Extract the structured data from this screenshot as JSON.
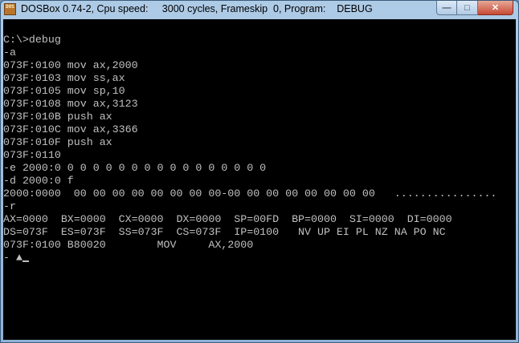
{
  "window": {
    "icon_text": "DOS",
    "title": "DOSBox 0.74-2, Cpu speed:     3000 cycles, Frameskip  0, Program:    DEBUG",
    "controls": {
      "minimize": "—",
      "maximize": "□",
      "close": "✕"
    }
  },
  "console": {
    "lines": [
      "C:\\>debug",
      "-a",
      "073F:0100 mov ax,2000",
      "073F:0103 mov ss,ax",
      "073F:0105 mov sp,10",
      "073F:0108 mov ax,3123",
      "073F:010B push ax",
      "073F:010C mov ax,3366",
      "073F:010F push ax",
      "073F:0110",
      "-e 2000:0 0 0 0 0 0 0 0 0 0 0 0 0 0 0 0 0",
      "-d 2000:0 f",
      "2000:0000  00 00 00 00 00 00 00 00-00 00 00 00 00 00 00 00   ................",
      "-r",
      "AX=0000  BX=0000  CX=0000  DX=0000  SP=00FD  BP=0000  SI=0000  DI=0000",
      "DS=073F  ES=073F  SS=073F  CS=073F  IP=0100   NV UP EI PL NZ NA PO NC",
      "073F:0100 B80020        MOV     AX,2000"
    ],
    "prompt": "- ",
    "arrow_glyph": "▲"
  }
}
